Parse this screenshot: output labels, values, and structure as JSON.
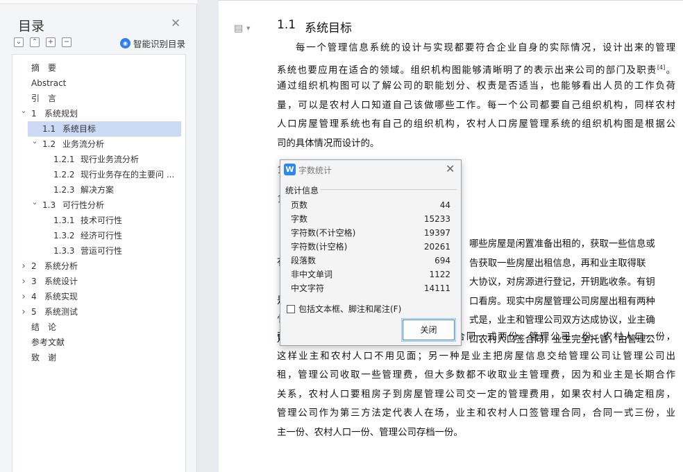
{
  "toc": {
    "title": "目录",
    "tools": [
      "⌄",
      "⌃",
      "+",
      "−"
    ],
    "smart_label": "智能识别目录",
    "items": [
      {
        "level": 0,
        "num": "",
        "text": "摘　要",
        "caret": "",
        "selected": false
      },
      {
        "level": 0,
        "num": "",
        "text": "Abstract",
        "caret": "",
        "selected": false
      },
      {
        "level": 0,
        "num": "",
        "text": "引　言",
        "caret": "",
        "selected": false
      },
      {
        "level": 0,
        "num": "1",
        "text": "系统规划",
        "caret": "v",
        "selected": false
      },
      {
        "level": 1,
        "num": "1.1",
        "text": "系统目标",
        "caret": "",
        "selected": true
      },
      {
        "level": 1,
        "num": "1.2",
        "text": "业务流分析",
        "caret": "v",
        "selected": false
      },
      {
        "level": 2,
        "num": "1.2.1",
        "text": "现行业务流分析",
        "caret": "",
        "selected": false
      },
      {
        "level": 2,
        "num": "1.2.2",
        "text": "现行业务存在的主要问 ...",
        "caret": "",
        "selected": false
      },
      {
        "level": 2,
        "num": "1.2.3",
        "text": "解决方案",
        "caret": "",
        "selected": false
      },
      {
        "level": 1,
        "num": "1.3",
        "text": "可行性分析",
        "caret": "v",
        "selected": false
      },
      {
        "level": 2,
        "num": "1.3.1",
        "text": "技术可行性",
        "caret": "",
        "selected": false
      },
      {
        "level": 2,
        "num": "1.3.2",
        "text": "经济可行性",
        "caret": "",
        "selected": false
      },
      {
        "level": 2,
        "num": "1.3.3",
        "text": "营运可行性",
        "caret": "",
        "selected": false
      },
      {
        "level": 0,
        "num": "2",
        "text": "系统分析",
        "caret": ">",
        "selected": false
      },
      {
        "level": 0,
        "num": "3",
        "text": "系统设计",
        "caret": ">",
        "selected": false
      },
      {
        "level": 0,
        "num": "4",
        "text": "系统实现",
        "caret": ">",
        "selected": false
      },
      {
        "level": 0,
        "num": "5",
        "text": "系统测试",
        "caret": ">",
        "selected": false
      },
      {
        "level": 0,
        "num": "",
        "text": "结　论",
        "caret": "",
        "selected": false
      },
      {
        "level": 0,
        "num": "",
        "text": "参考文献",
        "caret": "",
        "selected": false
      },
      {
        "level": 0,
        "num": "",
        "text": "致　谢",
        "caret": "",
        "selected": false
      }
    ]
  },
  "document": {
    "heading_num": "1.1",
    "heading_title": "系统目标",
    "para1": [
      "每一个管理信息系统的设计与实现都要符合企业自身的实际情况，设计出来的管理",
      "系统也要应用在适合的领域。组织机构图能够清晰明了的表示出来公司的部门及职责",
      "通过组织机构图可以了解公司的职能划分、权责是否适当，也能够看出人员的工作负荷",
      "量，可以是农村人口知道自己该做哪些工作。每一个公司都要自己组织机构，同样农村",
      "人口房屋管理系统也有自己的组织机构，农村人口房屋管理系统的组织机构图是根据公",
      "司的具体情况而设计的。"
    ],
    "ref_mark": "[4]",
    "hidden_marks": [
      "1",
      "1"
    ],
    "para2_partial": [
      "哪些房屋是闲置准备出租的，获取一些信息或",
      "告获取一些房屋出租信息，再和业主取得联",
      "大协议，对房源进行登记，开钥匙收条。有钥",
      "口看房。现实中房屋管理公司房屋出租有两种",
      "式是，业主和管理公司双方达成协议，业主确",
      "口农村人口签合同，业主完全托管，由管理公"
    ],
    "para2_partial_prefix": [
      "",
      "有",
      "",
      "是",
      "忄",
      "定"
    ],
    "para2": [
      "司和农村人口签合同的方式进行出租，合同一式两份、管理公司一份、农村人口一份，",
      "这样业主和农村人口不用见面；另一种是业主把房屋信息交给管理公司让管理公司出",
      "租，管理公司收取一些管理费，但大多数都不收取业主管理费，因为和业主是长期合作",
      "关系，农村人口要租房子到房屋管理公司交一定的管理费用，如果农村人口确定租房，",
      "管理公司作为第三方法定代表人在场，业主和农村人口签管理合同，合同一式三份，业",
      "主一份、农村人口一份、管理公司存档一份。"
    ]
  },
  "dialog": {
    "logo": "W",
    "title": "字数统计",
    "group_label": "统计信息",
    "stats": [
      {
        "label": "页数",
        "value": "44"
      },
      {
        "label": "字数",
        "value": "15233"
      },
      {
        "label": "字符数(不计空格)",
        "value": "19397"
      },
      {
        "label": "字符数(计空格)",
        "value": "20261"
      },
      {
        "label": "段落数",
        "value": "694"
      },
      {
        "label": "非中文单词",
        "value": "1122"
      },
      {
        "label": "中文字符",
        "value": "14111"
      }
    ],
    "checkbox_label": "包括文本框、脚注和尾注(F)",
    "checkbox_checked": false,
    "close_button": "关闭"
  }
}
